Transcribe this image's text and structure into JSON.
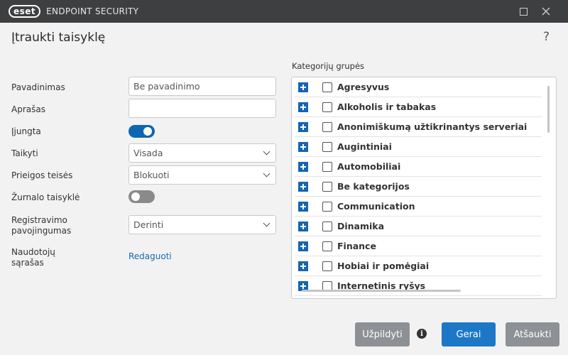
{
  "window": {
    "logo_text": "eset",
    "app_name": "ENDPOINT SECURITY"
  },
  "header": {
    "title": "Įtraukti taisyklę",
    "help": "?"
  },
  "form": {
    "name_label": "Pavadinimas",
    "name_value": "Be pavadinimo",
    "description_label": "Aprašas",
    "description_value": "",
    "enabled_label": "Įjungta",
    "enabled": true,
    "apply_label": "Taikyti",
    "apply_value": "Visada",
    "access_label": "Prieigos teisės",
    "access_value": "Blokuoti",
    "log_rule_label": "Žurnalo taisyklė",
    "log_rule": false,
    "log_severity_label_1": "Registravimo",
    "log_severity_label_2": "pavojingumas",
    "log_severity_value": "Derinti",
    "user_list_label_1": "Naudotojų",
    "user_list_label_2": "sąrašas",
    "user_list_link": "Redaguoti"
  },
  "categories": {
    "label": "Kategorijų grupės",
    "items": [
      "Agresyvus",
      "Alkoholis ir tabakas",
      "Anonimiškumą užtikrinantys serveriai",
      "Augintiniai",
      "Automobiliai",
      "Be kategorijos",
      "Communication",
      "Dinamika",
      "Finance",
      "Hobiai ir pomėgiai",
      "Internetinis ryšys"
    ]
  },
  "footer": {
    "fill_label": "Užpildyti",
    "info_icon": "i",
    "ok_label": "Gerai",
    "cancel_label": "Atšaukti"
  }
}
